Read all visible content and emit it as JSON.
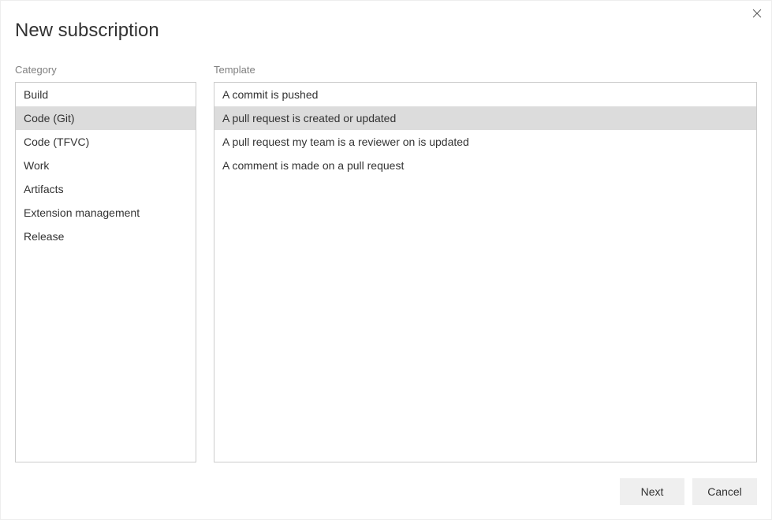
{
  "dialog": {
    "title": "New subscription"
  },
  "category": {
    "label": "Category",
    "items": [
      {
        "label": "Build",
        "selected": false
      },
      {
        "label": "Code (Git)",
        "selected": true
      },
      {
        "label": "Code (TFVC)",
        "selected": false
      },
      {
        "label": "Work",
        "selected": false
      },
      {
        "label": "Artifacts",
        "selected": false
      },
      {
        "label": "Extension management",
        "selected": false
      },
      {
        "label": "Release",
        "selected": false
      }
    ]
  },
  "template": {
    "label": "Template",
    "items": [
      {
        "label": "A commit is pushed",
        "selected": false
      },
      {
        "label": "A pull request is created or updated",
        "selected": true
      },
      {
        "label": "A pull request my team is a reviewer on is updated",
        "selected": false
      },
      {
        "label": "A comment is made on a pull request",
        "selected": false
      }
    ]
  },
  "footer": {
    "next": "Next",
    "cancel": "Cancel"
  }
}
